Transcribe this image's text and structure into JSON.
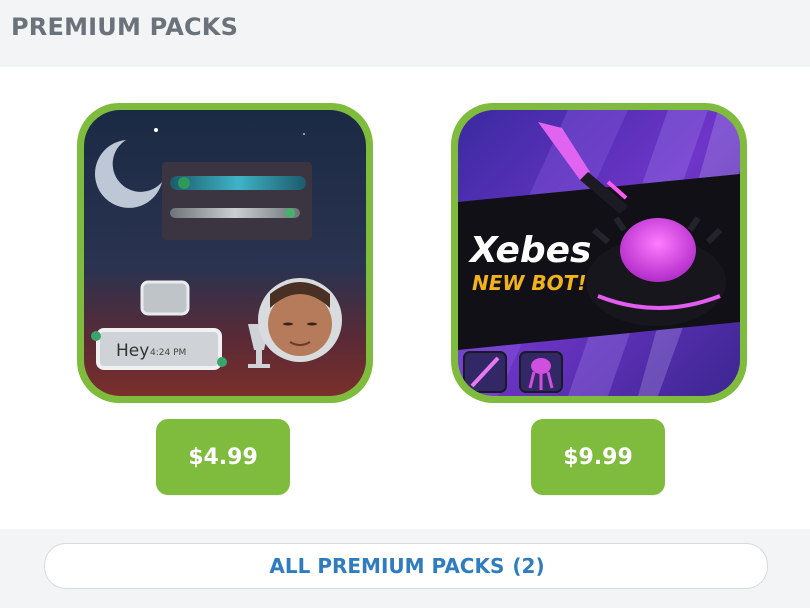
{
  "header": {
    "title": "PREMIUM PACKS"
  },
  "packs": [
    {
      "chat_bubble_text": "Hey",
      "chat_bubble_time": "4:24 PM",
      "price": "$4.99"
    },
    {
      "title_line1": "Xebes",
      "title_line2": "NEW BOT!",
      "price": "$9.99"
    }
  ],
  "footer": {
    "all_label": "ALL PREMIUM PACKS",
    "all_count": "(2)"
  },
  "colors": {
    "accent_green": "#7fbc3e",
    "link_blue": "#2f7cc1",
    "header_gray": "#6b7279"
  }
}
